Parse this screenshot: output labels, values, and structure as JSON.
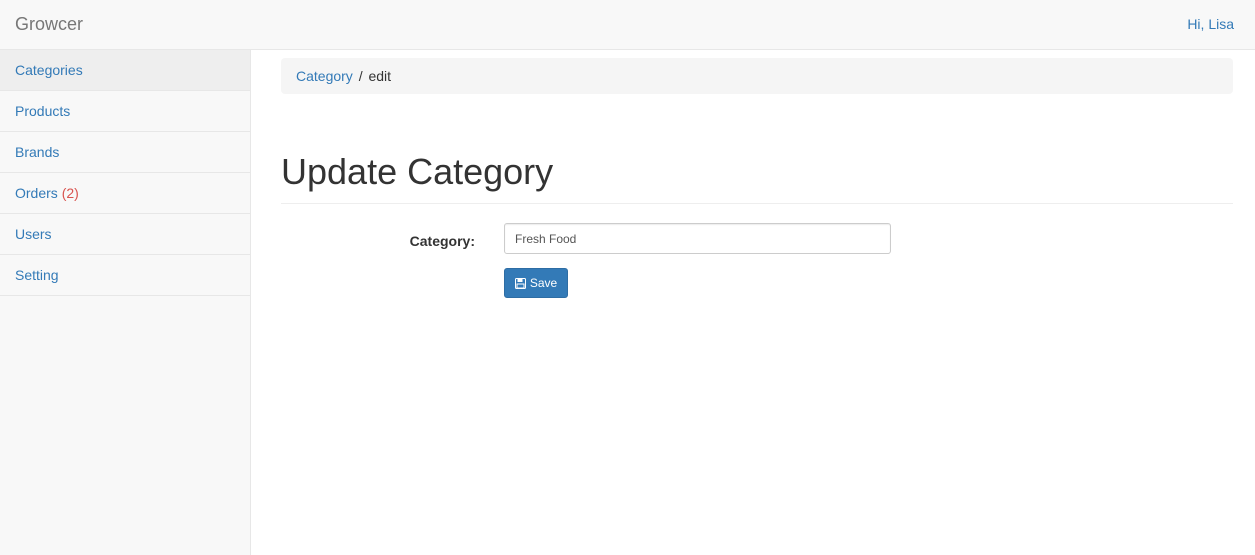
{
  "navbar": {
    "brand": "Growcer",
    "user_greeting": "Hi, Lisa"
  },
  "sidebar": {
    "items": [
      {
        "label": "Categories",
        "active": true
      },
      {
        "label": "Products"
      },
      {
        "label": "Brands"
      },
      {
        "label": "Orders",
        "badge": "(2)"
      },
      {
        "label": "Users"
      },
      {
        "label": "Setting"
      }
    ]
  },
  "breadcrumb": {
    "link": "Category",
    "separator": "/",
    "current": "edit"
  },
  "page": {
    "title": "Update Category"
  },
  "form": {
    "category_label": "Category:",
    "category_value": "Fresh Food",
    "save_label": "Save",
    "save_icon": "floppy-disk-icon"
  },
  "colors": {
    "link": "#337ab7",
    "badge": "#d9534f",
    "primary_button": "#337ab7"
  }
}
